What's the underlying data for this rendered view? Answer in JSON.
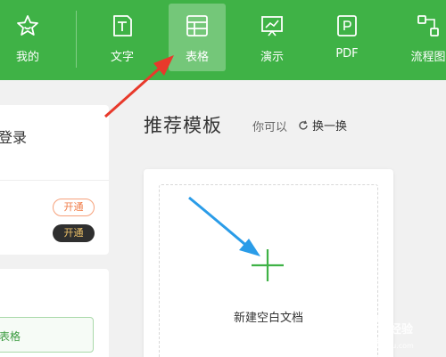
{
  "toolbar": {
    "tabs": [
      {
        "label": "我的",
        "icon": "star-icon"
      },
      {
        "label": "文字",
        "icon": "document-icon"
      },
      {
        "label": "表格",
        "icon": "table-icon",
        "active": true
      },
      {
        "label": "演示",
        "icon": "presentation-icon"
      },
      {
        "label": "PDF",
        "icon": "pdf-icon"
      },
      {
        "label": "流程图",
        "icon": "flowchart-icon"
      }
    ]
  },
  "left": {
    "login_text": "登录",
    "open_btn1": "开通",
    "open_btn2": "开通",
    "biaoge_btn": "表格"
  },
  "recommend": {
    "title": "推荐模板",
    "sub": "你可以",
    "refresh": "换一换"
  },
  "new_doc": {
    "label": "新建空白文档"
  },
  "watermark": {
    "text": "经验",
    "url": "jingyan.baidu.com"
  },
  "colors": {
    "brand_green": "#3fb246",
    "arrow_red": "#e8392b",
    "arrow_blue": "#2a9ce8"
  }
}
